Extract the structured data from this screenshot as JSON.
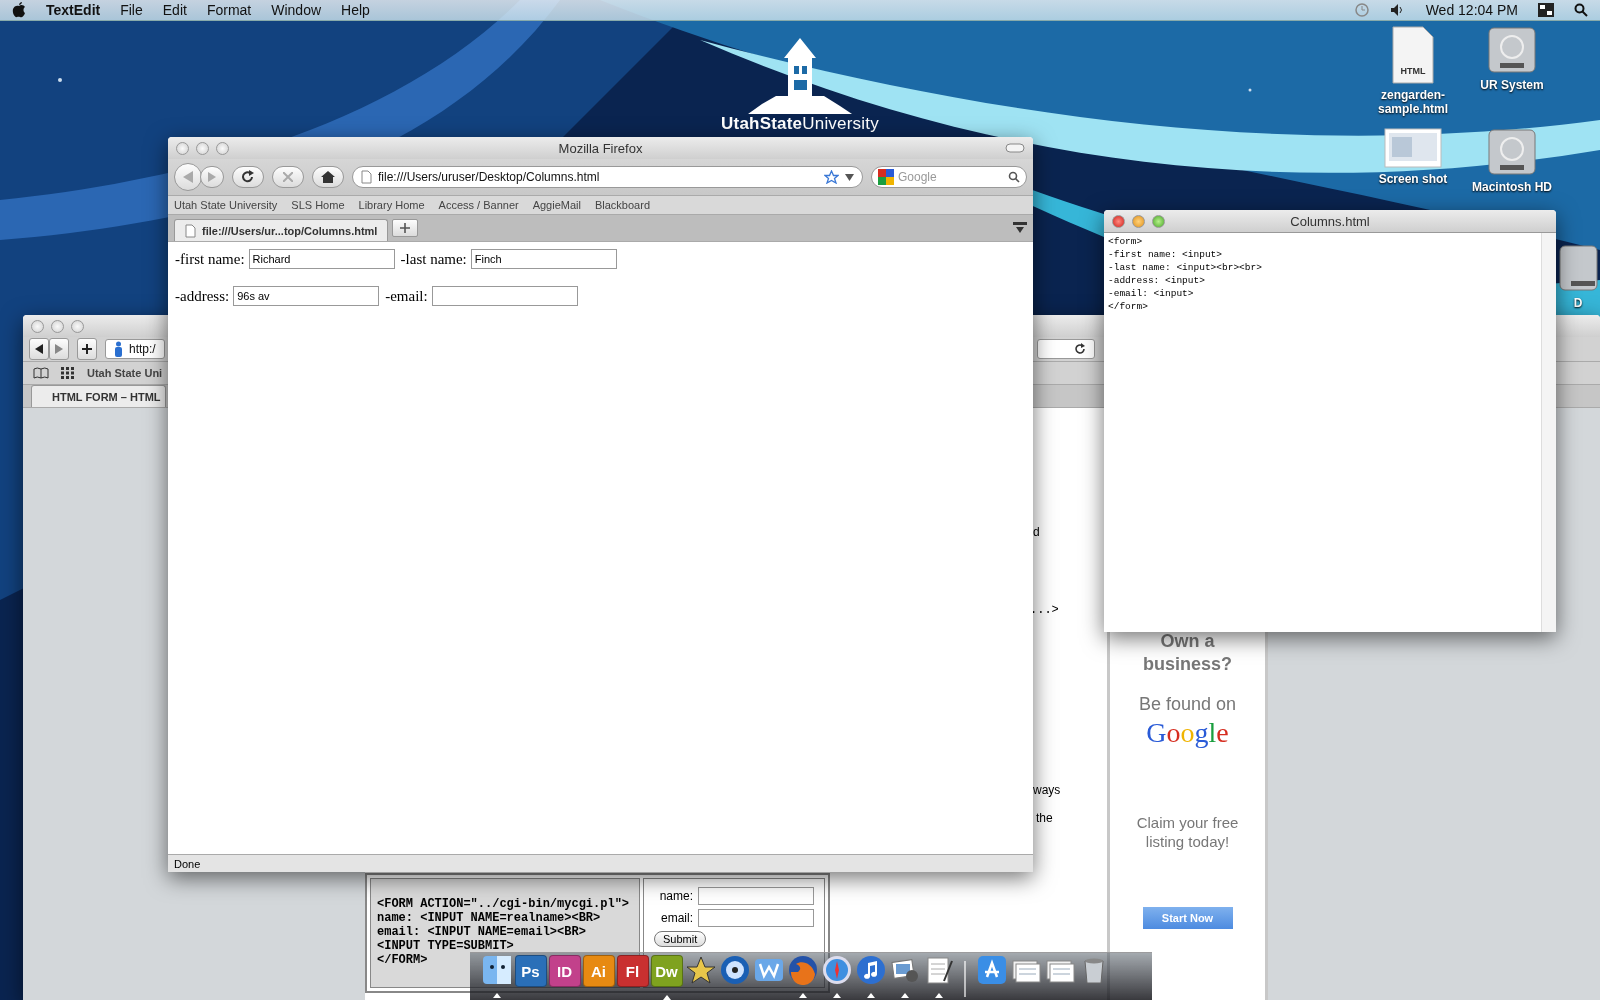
{
  "menu_bar": {
    "app": "TextEdit",
    "items": [
      "File",
      "Edit",
      "Format",
      "Window",
      "Help"
    ],
    "clock": "Wed 12:04 PM"
  },
  "desktop": {
    "logo": "**UtahState**University",
    "icons": [
      {
        "kind": "html",
        "badge": "HTML",
        "label": "zengarden-sample.html"
      },
      {
        "kind": "drive",
        "label": "UR System"
      },
      {
        "kind": "screenshot",
        "label": "Screen shot"
      },
      {
        "kind": "drive",
        "label": "Macintosh HD"
      },
      {
        "kind": "drive",
        "label": "D"
      }
    ]
  },
  "safari": {
    "url": "http:/",
    "bookmark": "Utah State Uni",
    "tab": {
      "label": "HTML FORM – HTML",
      "selected": true
    },
    "fragments": [
      "d",
      "...>",
      "ways",
      "the"
    ],
    "ad": {
      "heading": "Own a business?",
      "line": "Be found on",
      "logo": "Google",
      "claim": "Claim your free listing today!",
      "button": "Start Now"
    },
    "code": [
      "<FORM ACTION=\"../cgi-bin/mycgi.pl\">",
      "name: <INPUT NAME=realname><BR>",
      "email: <INPUT NAME=email><BR>",
      "<INPUT TYPE=SUBMIT>",
      "</FORM>"
    ],
    "demo_fields": [
      "name:",
      "email:"
    ],
    "demo_button": "Submit"
  },
  "firefox": {
    "title": "Mozilla Firefox",
    "url": "file:///Users/uruser/Desktop/Columns.html",
    "search": {
      "placeholder": "Google"
    },
    "bookmarks": [
      "Utah State University",
      "SLS Home",
      "Library Home",
      "Access / Banner",
      "AggieMail",
      "Blackboard"
    ],
    "tabs": [
      {
        "label": "file:///Users/ur...top/Columns.html",
        "selected": true
      }
    ],
    "form_rows": [
      [
        {
          "label": "-first name:",
          "value": "Richard"
        },
        {
          "label": "-last name:",
          "value": "Finch"
        }
      ],
      [
        {
          "label": "-address:",
          "value": "96s av"
        },
        {
          "label": "-email:"
        }
      ]
    ],
    "status": "Done"
  },
  "textedit": {
    "title": "Columns.html",
    "lines": [
      "<form>",
      "-first name: <input>",
      "-last name: <input><br><br>",
      "-address: <input>",
      "-email: <input>",
      "</form>"
    ]
  },
  "dock": [
    {
      "kind": "finder",
      "running": true
    },
    {
      "kind": "app",
      "label": "Ps",
      "color": "#2a6fb8",
      "running": false
    },
    {
      "kind": "app",
      "label": "ID",
      "color": "#c2418b",
      "running": false
    },
    {
      "kind": "app",
      "label": "Ai",
      "color": "#e78a12",
      "running": false
    },
    {
      "kind": "app",
      "label": "Fl",
      "color": "#c93030",
      "running": false
    },
    {
      "kind": "app",
      "label": "Dw",
      "color": "#7fa21f",
      "running": true
    },
    {
      "kind": "star",
      "running": false
    },
    {
      "kind": "dvd",
      "running": false
    },
    {
      "kind": "word",
      "running": false
    },
    {
      "kind": "firefox",
      "running": true
    },
    {
      "kind": "safari",
      "running": true
    },
    {
      "kind": "itunes",
      "running": true
    },
    {
      "kind": "preview",
      "running": true
    },
    {
      "kind": "textedit",
      "running": true
    },
    {
      "kind": "separator"
    },
    {
      "kind": "appstore",
      "running": false
    },
    {
      "kind": "stack",
      "running": false
    },
    {
      "kind": "stack",
      "running": false
    },
    {
      "kind": "trash",
      "running": false
    }
  ]
}
